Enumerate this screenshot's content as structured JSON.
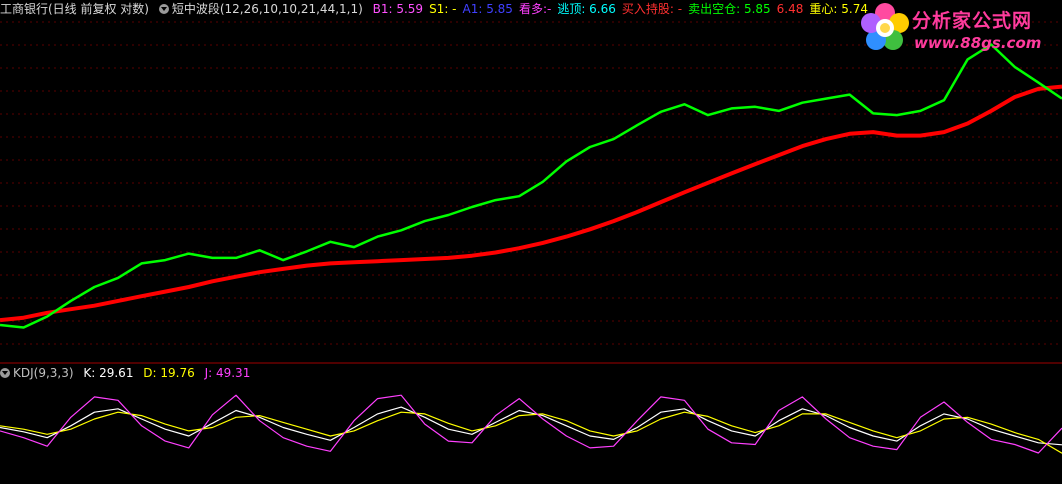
{
  "header": {
    "stock": "工商银行(日线 前复权 对数)",
    "indicator": "短中波段(12,26,10,10,21,44,1,1)",
    "items": [
      {
        "label": "B1: 5.59",
        "color": "#ff50ff"
      },
      {
        "label": "S1: -",
        "color": "#ffff00"
      },
      {
        "label": "A1: 5.85",
        "color": "#4040ff"
      },
      {
        "label": "看多:-",
        "color": "#ff40ff"
      },
      {
        "label": "逃顶: 6.66",
        "color": "#00ffff"
      },
      {
        "label": "买入持股: -",
        "color": "#ff3030"
      },
      {
        "label": "卖出空仓: 5.85",
        "color": "#00ff00"
      },
      {
        "label": "6.48",
        "color": "#ff3030"
      },
      {
        "label": "重心: 5.74",
        "color": "#ffff00"
      }
    ]
  },
  "logo": {
    "title": "分析家公式网",
    "url": "www.88gs.com"
  },
  "kdj": {
    "name": "KDJ(9,3,3)",
    "k_label": "K: 29.61",
    "d_label": "D: 19.76",
    "j_label": "J: 49.31",
    "colors": {
      "k": "#ffffff",
      "d": "#ffff00",
      "j": "#ff40ff"
    }
  },
  "chart_data": [
    {
      "type": "line",
      "title": "短中波段",
      "scale": "log",
      "grid": true,
      "series": [
        {
          "name": "",
          "color": "#ff0000",
          "values": [
            4.46,
            4.48,
            4.52,
            4.55,
            4.58,
            4.62,
            4.66,
            4.7,
            4.74,
            4.79,
            4.83,
            4.87,
            4.9,
            4.93,
            4.95,
            4.96,
            4.97,
            4.98,
            4.99,
            5.0,
            5.02,
            5.05,
            5.09,
            5.14,
            5.2,
            5.27,
            5.35,
            5.44,
            5.54,
            5.64,
            5.74,
            5.84,
            5.94,
            6.04,
            6.14,
            6.22,
            6.28,
            6.3,
            6.26,
            6.26,
            6.3,
            6.4,
            6.55,
            6.72,
            6.82,
            6.85
          ]
        },
        {
          "name": "",
          "color": "#00ff00",
          "values": [
            4.42,
            4.4,
            4.49,
            4.62,
            4.74,
            4.82,
            4.95,
            4.98,
            5.04,
            5.0,
            5.0,
            5.07,
            4.98,
            5.06,
            5.15,
            5.1,
            5.2,
            5.26,
            5.35,
            5.41,
            5.49,
            5.56,
            5.6,
            5.75,
            5.97,
            6.13,
            6.22,
            6.38,
            6.54,
            6.63,
            6.5,
            6.58,
            6.6,
            6.55,
            6.65,
            6.7,
            6.75,
            6.52,
            6.5,
            6.55,
            6.68,
            7.2,
            7.4,
            7.1,
            6.9,
            6.7
          ]
        }
      ]
    },
    {
      "type": "line",
      "title": "KDJ(9,3,3)",
      "ylim": [
        0,
        100
      ],
      "series": [
        {
          "name": "K",
          "color": "#ffffff",
          "values": [
            50,
            45,
            38,
            52,
            68,
            72,
            60,
            48,
            40,
            55,
            70,
            62,
            50,
            42,
            35,
            50,
            66,
            74,
            62,
            48,
            42,
            56,
            70,
            64,
            52,
            40,
            36,
            50,
            68,
            72,
            58,
            46,
            40,
            58,
            72,
            64,
            50,
            40,
            34,
            52,
            66,
            60,
            48,
            40,
            32,
            29.61
          ]
        },
        {
          "name": "D",
          "color": "#ffff00",
          "values": [
            52,
            48,
            42,
            48,
            60,
            68,
            64,
            54,
            46,
            50,
            62,
            64,
            56,
            48,
            40,
            46,
            58,
            68,
            66,
            55,
            46,
            52,
            64,
            66,
            58,
            46,
            40,
            46,
            60,
            68,
            63,
            52,
            44,
            52,
            66,
            66,
            56,
            46,
            38,
            46,
            60,
            62,
            54,
            44,
            36,
            19.76
          ]
        },
        {
          "name": "J",
          "color": "#ff40ff",
          "values": [
            46,
            38,
            28,
            62,
            86,
            82,
            52,
            34,
            26,
            65,
            88,
            58,
            38,
            28,
            22,
            58,
            84,
            88,
            54,
            34,
            32,
            64,
            84,
            60,
            40,
            26,
            28,
            58,
            86,
            82,
            48,
            32,
            30,
            70,
            86,
            60,
            38,
            28,
            24,
            62,
            80,
            56,
            36,
            30,
            20,
            49.31
          ]
        }
      ]
    }
  ]
}
